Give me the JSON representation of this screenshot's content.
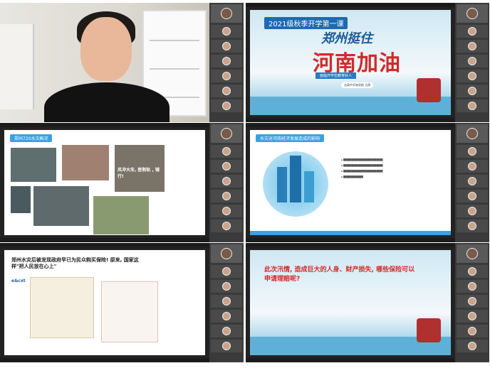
{
  "cells": {
    "cell2": {
      "heading": "2021级秋季开学第一课",
      "title_line1": "郑州挺住",
      "title_line2": "河南加油",
      "tag": "面临开学伍教育好人",
      "button": "达高中开始导航  立即"
    },
    "cell3": {
      "heading": "郑州720水灾概况",
      "photo_caption": "风冲大车, 医制轨 , 铺行!"
    },
    "cell4": {
      "heading": "水灾对河南经济发展造成的影响"
    },
    "cell5": {
      "title": "郑州水灾后被发现政府早已为民众购买保险! 原来, 国家这样\"把人民放在心上\"",
      "logo": "e&cxt"
    },
    "cell6": {
      "question": "此次汛情, 造成巨大的人身、财产损失, 哪些保险可以申请理赔呢?"
    }
  },
  "colors": {
    "accent": "#3da0e0",
    "red": "#d22a2a",
    "dark_bg": "#222222"
  }
}
